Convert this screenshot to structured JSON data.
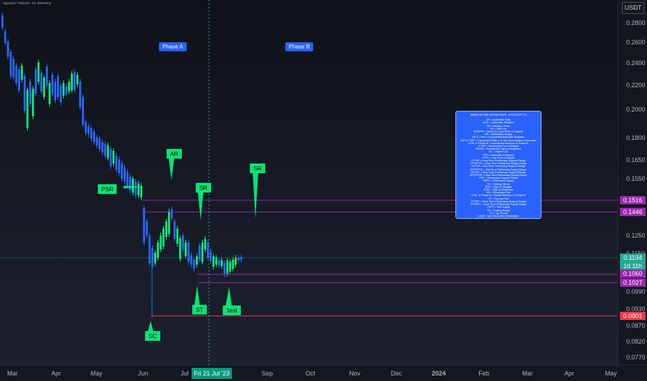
{
  "header": {
    "title": "Algorand / Tetherch, 1D, BINANCE",
    "currency": "USDT"
  },
  "price_axis": {
    "ticks": [
      "0.2800",
      "0.2600",
      "0.2400",
      "0.2200",
      "0.2000",
      "0.1800",
      "0.1650",
      "0.1550",
      "0.1350",
      "0.1250",
      "0.1150",
      "0.0990",
      "0.0930",
      "0.0870",
      "0.0820",
      "0.0770"
    ],
    "labels": [
      {
        "text": "0.1516",
        "color": "#9c27b0"
      },
      {
        "text": "0.1446",
        "color": "#9c27b0"
      },
      {
        "text": "0.1134",
        "sub": "1d 11h",
        "color": "#22ab94"
      },
      {
        "text": "0.1060",
        "color": "#9c27b0"
      },
      {
        "text": "0.1027",
        "color": "#9c27b0"
      },
      {
        "text": "0.0901",
        "color": "#f23645"
      }
    ]
  },
  "time_axis": {
    "labels": [
      "Mar",
      "Apr",
      "May",
      "Jun",
      "Jul",
      "Aug",
      "Sep",
      "Oct",
      "Nov",
      "Dec",
      "2024",
      "Feb",
      "Mar",
      "Apr",
      "May"
    ],
    "crosshair_date": "Fri 21 Jul '23"
  },
  "annotations": {
    "phase_a": "Phase A",
    "phase_b": "Phase B",
    "psr": "PSR",
    "ar": "AR",
    "sr1": "SR",
    "sr2": "SR",
    "st": "ST",
    "test": "Test",
    "sc": "SC"
  },
  "legend_note": {
    "title": "ABREVIATION DEFINITIONS - WYCKOFF 2.0",
    "lines": [
      "AR = Automatic Rally",
      "A.Re. = Automatic Reaction",
      "BC = Buying Climax",
      "BU = Back Up",
      "BUEPSP = Back Up | Last Point of Support",
      "DR = Distribution Range",
      "EA-S / SEA = Exponential Automatic Reaction",
      "EW-S / TEE = Exponential Rally in D-Tier Accumulation Schematic",
      "E.Re. in Phase B = Exponential Reaction in Phase B",
      "E.T&P = Exponential Test of Supply",
      "ESOW = Exponential Sign of Weakness",
      "HL = Higher Low",
      "LPS = Last point of Support",
      "LPSY = Last Point of Supply",
      "LTPSP = Long Term Preliminary Support Range",
      "LTPSPYR = Long Term Preliminary Supply Range",
      "MTPSP = Mid Term Preliminary Support Range",
      "MTPSPYR = Mid Term Preliminary Supply Range",
      "NTPSP = Near Term Preliminary Support Range",
      "NTPSPYR = Near Term Preliminary Supply Range",
      "PSP = Preliminary Support Range",
      "PSPY = Preliminary Supply",
      "SC = Selling Climax",
      "SOS = Sign of Strength",
      "SOW = Sign of Weakness",
      "SR = Secondary Test",
      "S.Re. in Phase B = Simple Reaction in Phase B",
      "ST = Second Test",
      "STPSP = Short Term Preliminary Support Range",
      "STPSPY = Short Term Preliminary Supply Range",
      "TSPY = Test Supply",
      "TR = Trading Range",
      "UT = Up Thrust",
      "UTAD = Up Thrust After Distribution",
      "UTLPSY = Up Thrust|Last Point of Supply",
      "WBPLPSY = Weak Buying Pressure|Last Point of Supply"
    ]
  },
  "colors": {
    "background": "#131722",
    "bull": "#22ab94",
    "bull_candle": "#00e676",
    "bear_candle": "#2962ff",
    "purple_line": "#9c27b0",
    "red_line": "#f23645",
    "annotation_blue": "#2962ff",
    "annotation_green": "#00e676"
  }
}
